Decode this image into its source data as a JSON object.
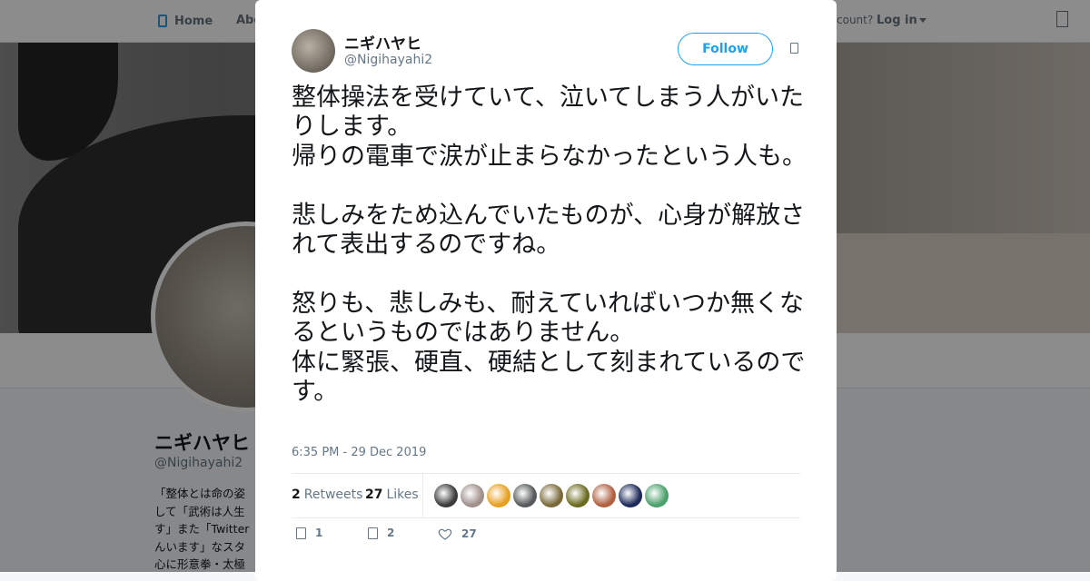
{
  "nav": {
    "home_label": "Home",
    "about_label": "Abo",
    "account_prompt": "count?",
    "login_label": "Log in"
  },
  "profile": {
    "name": "ニギハヤヒ",
    "handle": "@Nigihayahi2",
    "bio": "「整体とは命の姿\nして「武術は人生\nす」また「Twitter\nんいます」なスタ\n心に形意拳・太極"
  },
  "tweet": {
    "author_name": "ニギハヤヒ",
    "author_handle": "@Nigihayahi2",
    "follow_label": "Follow",
    "text": "整体操法を受けていて、泣いてしまう人がいたりします。\n帰りの電車で涙が止まらなかったという人も。\n\n悲しみをため込んでいたものが、心身が解放されて表出するのですね。\n\n怒りも、悲しみも、耐えていればいつか無くなるというものではありません。\n体に緊張、硬直、硬結として刻まれているのです。",
    "timestamp": "6:35 PM - 29 Dec 2019",
    "retweets_count": "2",
    "retweets_label": "Retweets",
    "likes_count": "27",
    "likes_label": "Likes",
    "reply_count": "1",
    "retweet_action_count": "2",
    "like_action_count": "27"
  },
  "liker_avatar_colors": [
    "#3b3b3b",
    "#a08f8a",
    "#e8a020",
    "#555a5a",
    "#7a6a3a",
    "#6b6b20",
    "#b06040",
    "#1d2a5a",
    "#4aa06a"
  ],
  "colors": {
    "accent": "#1da1f2",
    "muted": "#657786",
    "text": "#14171a"
  }
}
